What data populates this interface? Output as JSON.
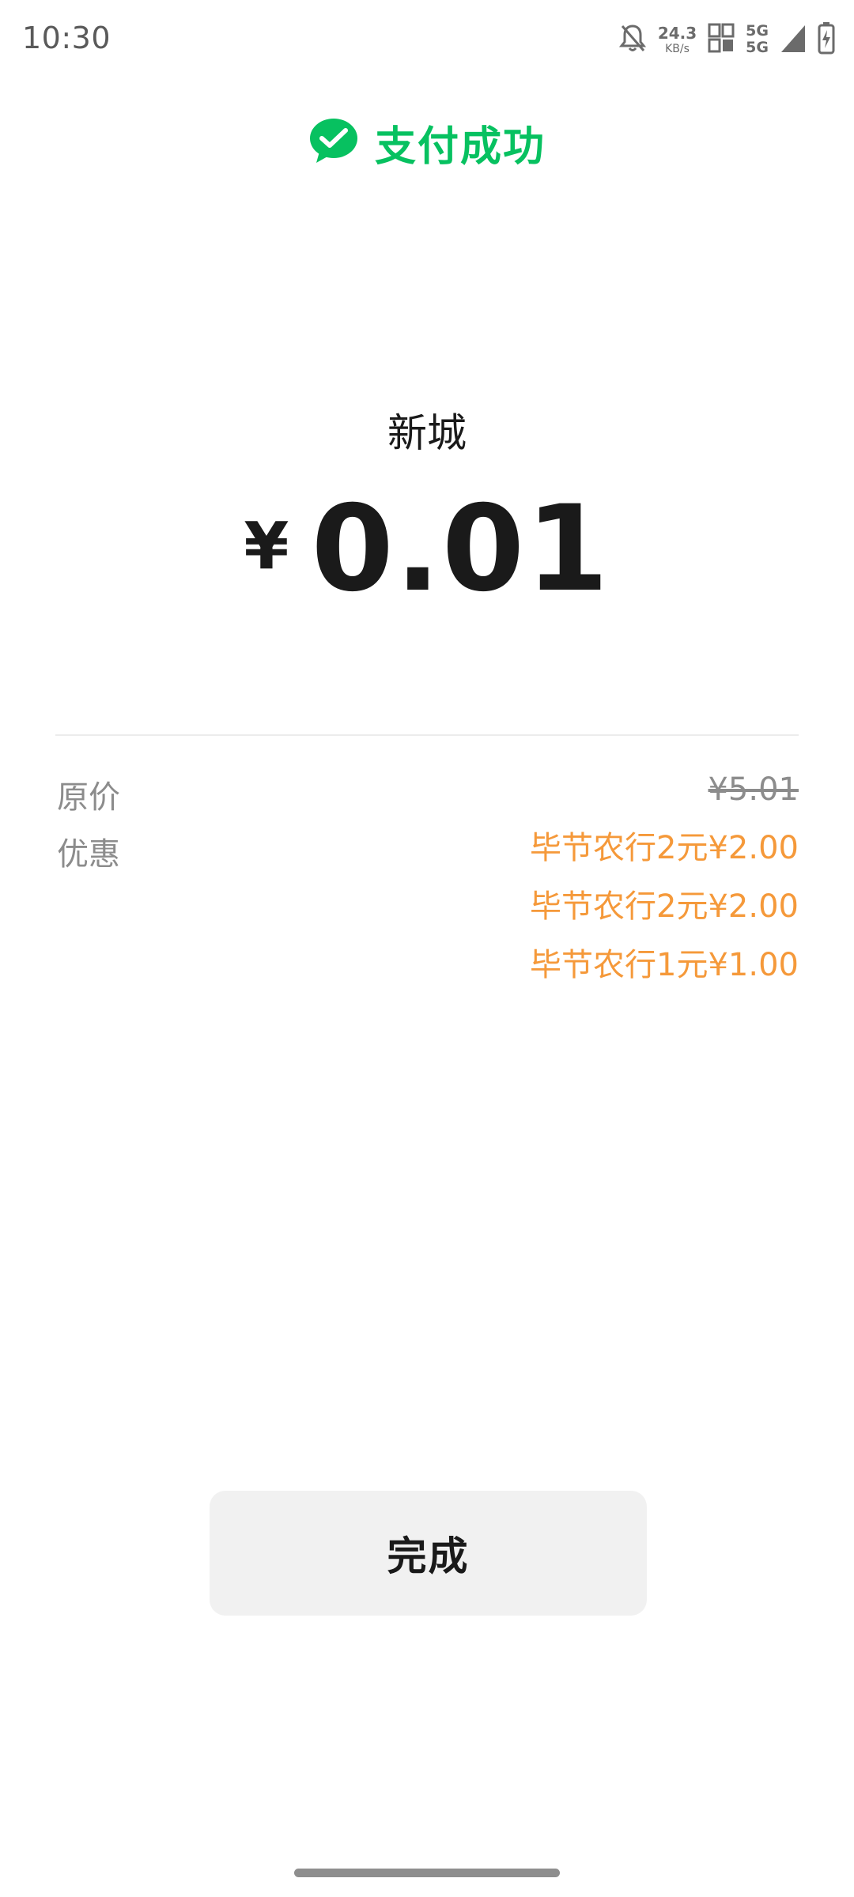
{
  "status_bar": {
    "time": "10:30",
    "net_speed_value": "24.3",
    "net_speed_unit": "KB/s",
    "network_top": "5G",
    "network_bottom": "5G"
  },
  "header": {
    "title": "支付成功",
    "brand_color": "#07c160",
    "icon": "wechat-pay-check-icon"
  },
  "payment": {
    "merchant": "新城",
    "currency": "¥",
    "amount": "0.01"
  },
  "details": {
    "original_label": "原价",
    "original_price": "¥5.01",
    "discount_label": "优惠",
    "discounts": [
      "毕节农行2元¥2.00",
      "毕节农行2元¥2.00",
      "毕节农行1元¥1.00"
    ],
    "discount_color": "#f5993a"
  },
  "actions": {
    "done_label": "完成"
  }
}
